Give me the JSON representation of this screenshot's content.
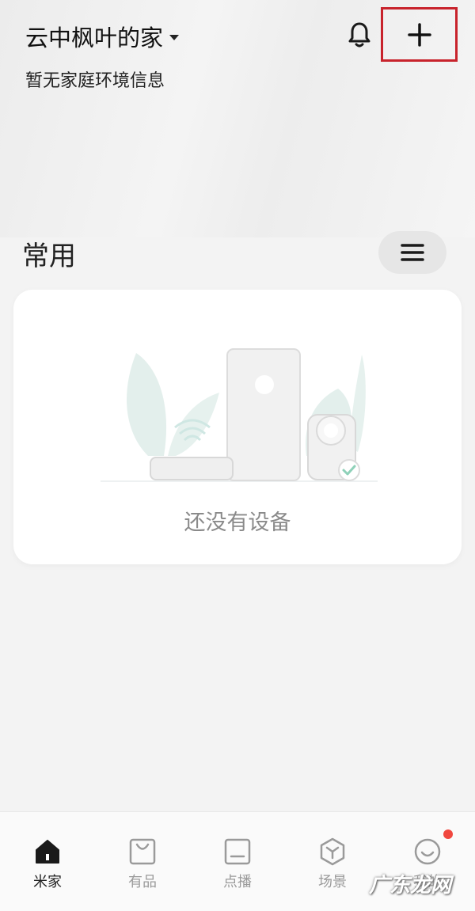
{
  "header": {
    "home_name": "云中枫叶的家",
    "env_info": "暂无家庭环境信息",
    "bell_icon": "bell-icon",
    "add_icon": "plus-icon"
  },
  "section": {
    "title": "常用",
    "menu_icon": "hamburger-icon"
  },
  "empty_state": {
    "text": "还没有设备",
    "illustration": "devices-illustration"
  },
  "tabbar": {
    "tabs": [
      {
        "label": "米家",
        "icon": "home-icon",
        "active": true
      },
      {
        "label": "有品",
        "icon": "shopping-bag-icon",
        "active": false
      },
      {
        "label": "点播",
        "icon": "play-screen-icon",
        "active": false
      },
      {
        "label": "场景",
        "icon": "scene-cube-icon",
        "active": false
      },
      {
        "label": "我的",
        "icon": "smiley-profile-icon",
        "active": false,
        "badge": true
      }
    ]
  },
  "watermark": "广东龙网",
  "colors": {
    "highlight_border": "#c8232c",
    "badge": "#f0473f",
    "active_tab": "#222222",
    "inactive_tab": "#9a9a9a"
  }
}
